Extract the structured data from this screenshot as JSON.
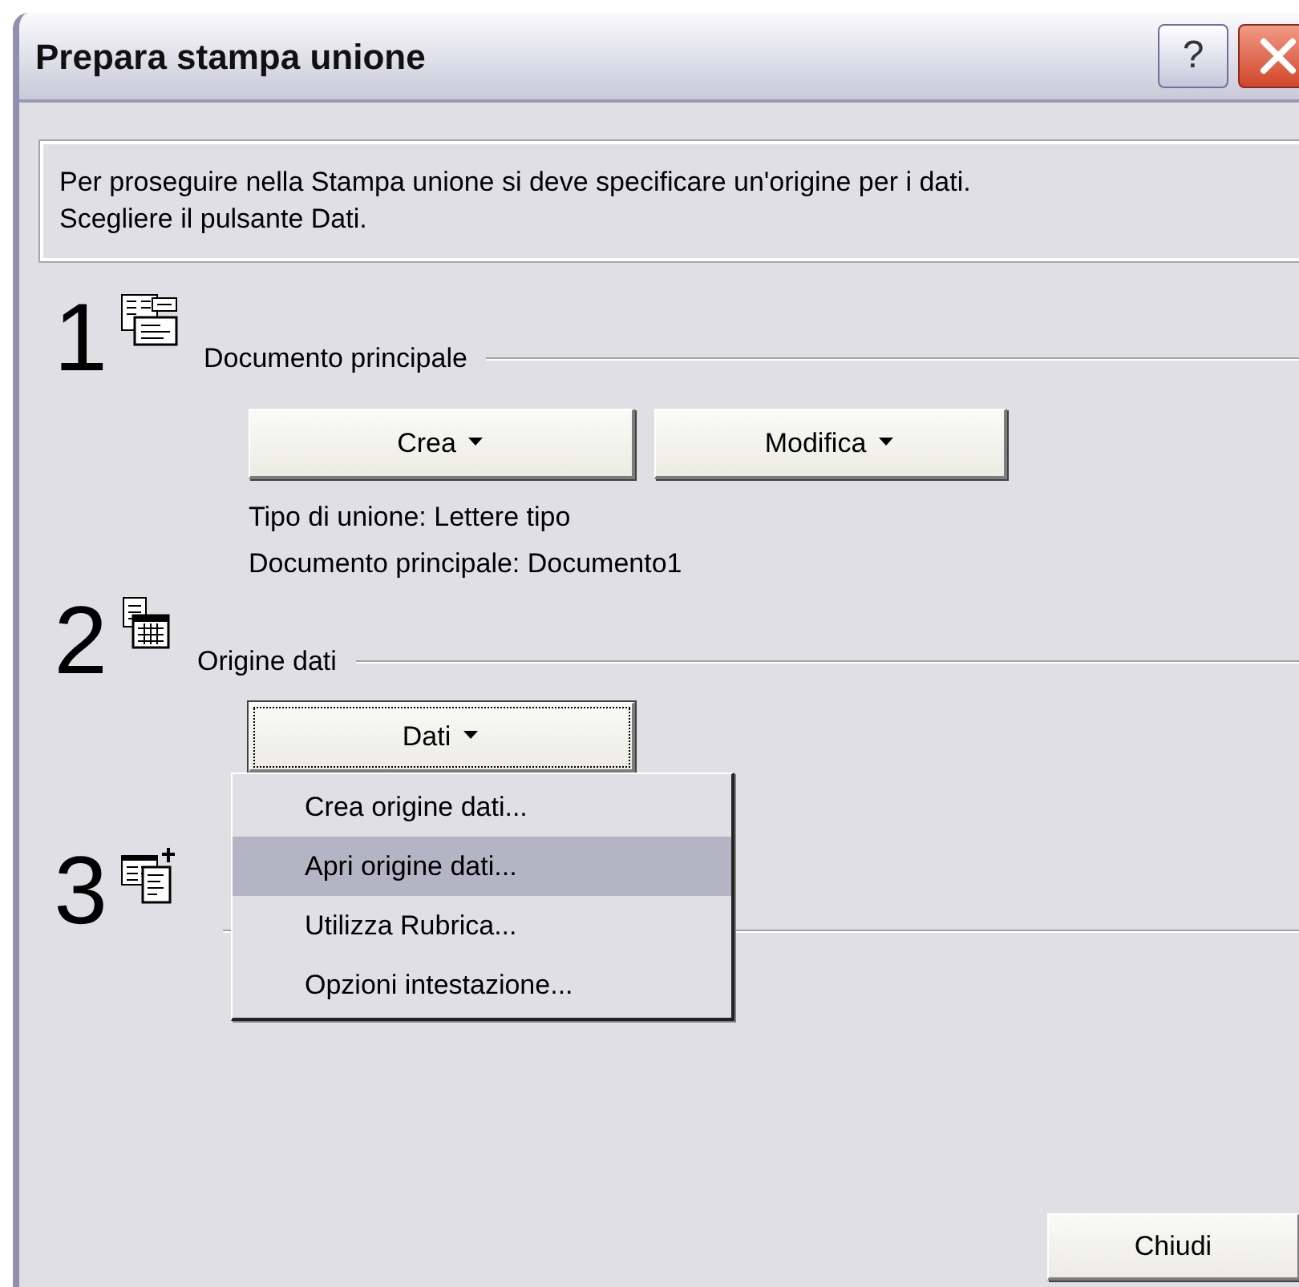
{
  "window": {
    "title": "Prepara stampa unione",
    "help_button": "?"
  },
  "instructions": "Per proseguire nella Stampa unione si deve specificare un'origine per i dati.\nScegliere il pulsante Dati.",
  "steps": [
    {
      "number": "1",
      "label": "Documento principale",
      "buttons": [
        {
          "label": "Crea",
          "focused": false
        },
        {
          "label": "Modifica",
          "focused": false
        }
      ],
      "info": [
        "Tipo di unione: Lettere tipo",
        "Documento principale: Documento1"
      ]
    },
    {
      "number": "2",
      "label": "Origine dati",
      "buttons": [
        {
          "label": "Dati",
          "focused": true
        }
      ]
    },
    {
      "number": "3"
    }
  ],
  "menu": {
    "items": [
      {
        "label": "Crea origine dati...",
        "selected": false
      },
      {
        "label": "Apri origine dati...",
        "selected": true
      },
      {
        "label": "Utilizza Rubrica...",
        "selected": false
      },
      {
        "label": "Opzioni intestazione...",
        "selected": false
      }
    ]
  },
  "footer_button": "Chiudi"
}
